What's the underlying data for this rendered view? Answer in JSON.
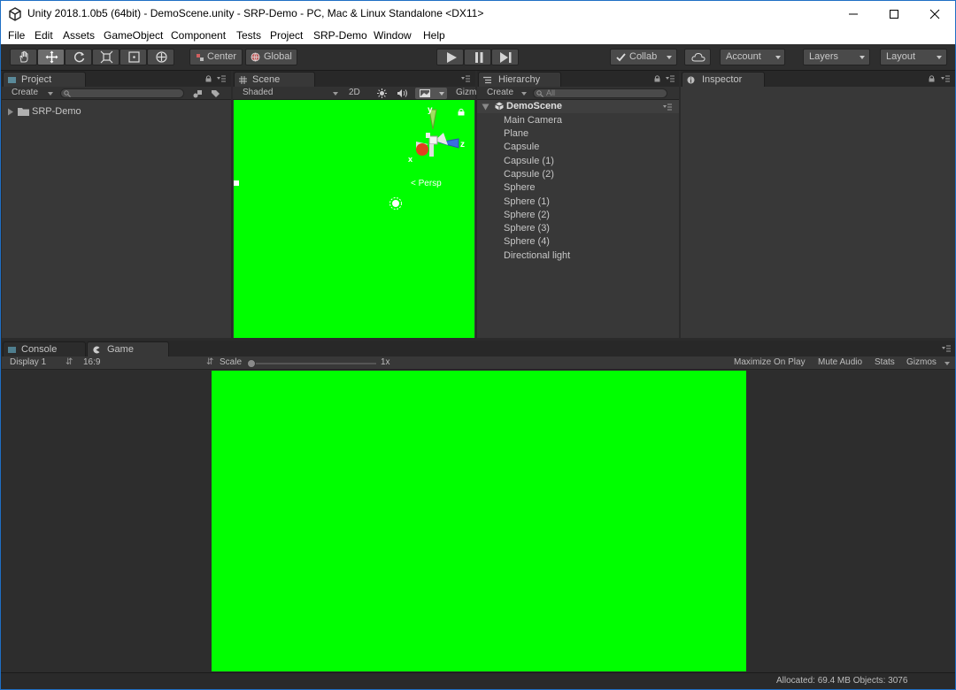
{
  "window": {
    "title": "Unity 2018.1.0b5 (64bit) - DemoScene.unity - SRP-Demo - PC, Mac & Linux Standalone <DX11>"
  },
  "menu": [
    "File",
    "Edit",
    "Assets",
    "GameObject",
    "Component",
    "Tests",
    "Project",
    "SRP-Demo",
    "Window",
    "Help"
  ],
  "toolbar": {
    "pivot_label": "Center",
    "space_label": "Global",
    "collab_label": "Collab",
    "account_label": "Account",
    "layers_label": "Layers",
    "layout_label": "Layout"
  },
  "project_panel": {
    "tab": "Project",
    "create_label": "Create",
    "folders": [
      "SRP-Demo"
    ]
  },
  "scene_panel": {
    "tab": "Scene",
    "shading": "Shaded",
    "mode_2d": "2D",
    "gizmos": "Gizm",
    "persp_label": "< Persp",
    "axis_y": "y",
    "axis_z": "z",
    "axis_x": "x",
    "background_color": "#00ff00"
  },
  "hierarchy_panel": {
    "tab": "Hierarchy",
    "create_label": "Create",
    "search_placeholder": "All",
    "scene_name": "DemoScene",
    "items": [
      "Main Camera",
      "Plane",
      "Capsule",
      "Capsule (1)",
      "Capsule (2)",
      "Sphere",
      "Sphere (1)",
      "Sphere (2)",
      "Sphere (3)",
      "Sphere (4)",
      "Directional light"
    ]
  },
  "inspector_panel": {
    "tab": "Inspector"
  },
  "bottom_panel": {
    "console_tab": "Console",
    "game_tab": "Game",
    "display": "Display 1",
    "aspect": "16:9",
    "scale_label": "Scale",
    "scale_value": "1x",
    "maximize": "Maximize On Play",
    "mute": "Mute Audio",
    "stats": "Stats",
    "gizmos": "Gizmos",
    "viewport_color": "#00ff00"
  },
  "status": {
    "allocated": "Allocated: 69.4 MB Objects: 3076"
  }
}
